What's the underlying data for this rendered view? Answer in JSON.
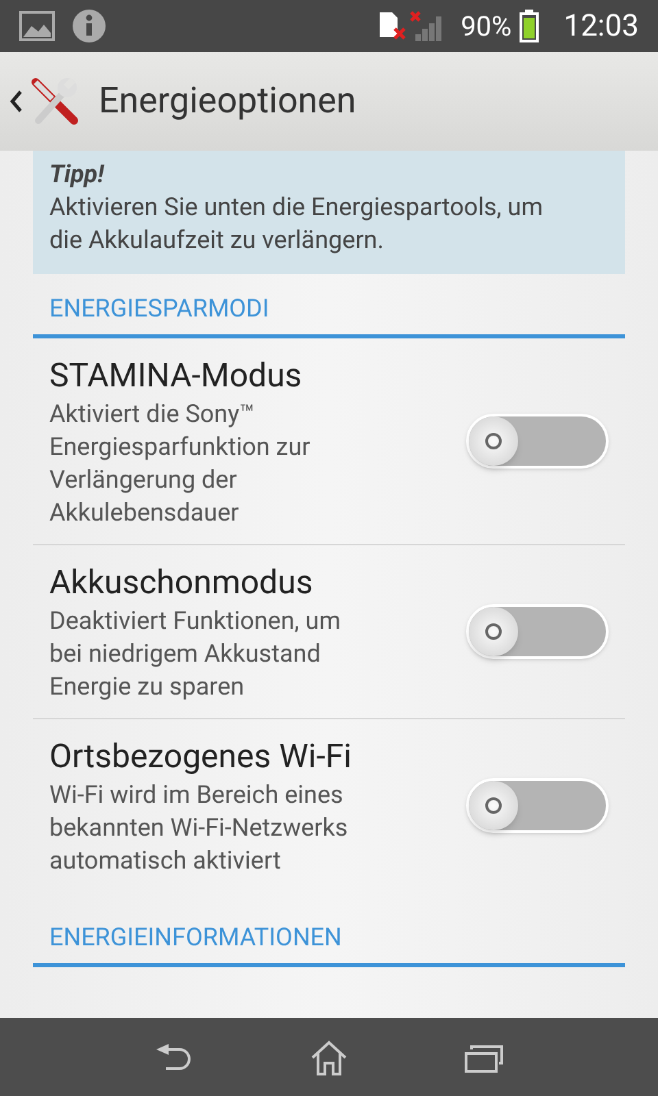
{
  "status_bar": {
    "battery_text": "90%",
    "time": "12:03"
  },
  "action_bar": {
    "title": "Energieoptionen"
  },
  "tip": {
    "title": "Tipp!",
    "text": "Aktivieren Sie unten die Energiespartools, um die Akkulaufzeit zu verlängern."
  },
  "sections": [
    {
      "title": "ENERGIESPARMODI",
      "items": [
        {
          "title": "STAMINA-Modus",
          "summary": "Aktiviert die Sony™ Energiesparfunktion zur Verlängerung der Akkulebensdauer",
          "on": false
        },
        {
          "title": "Akkuschonmodus",
          "summary": "Deaktiviert Funktionen, um bei niedrigem Akkustand Energie zu sparen",
          "on": false
        },
        {
          "title": "Ortsbezogenes Wi-Fi",
          "summary": "Wi-Fi wird im Bereich eines bekannten Wi-Fi-Netzwerks automatisch aktiviert",
          "on": false
        }
      ]
    },
    {
      "title": "ENERGIEINFORMATIONEN"
    }
  ]
}
